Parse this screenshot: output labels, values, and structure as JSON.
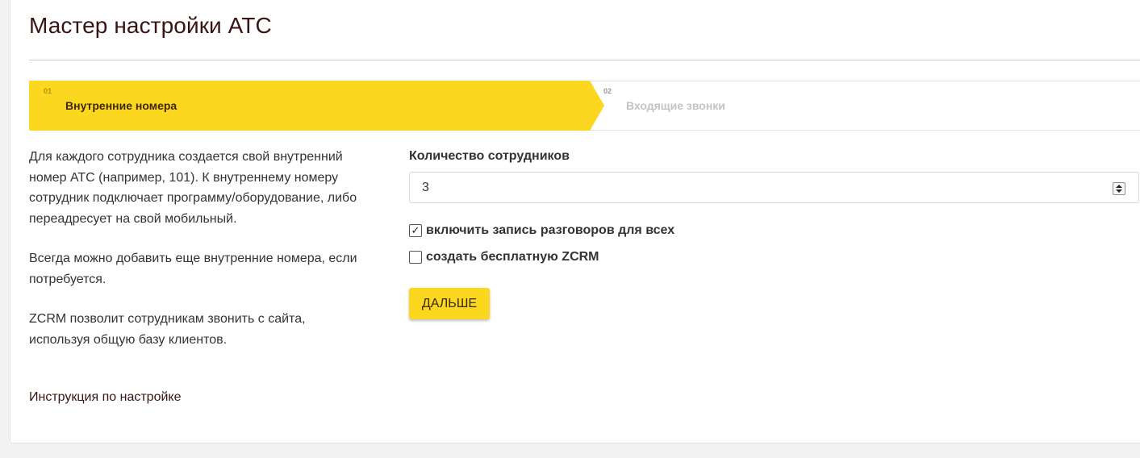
{
  "page_title": "Мастер настройки АТС",
  "steps": [
    {
      "num": "01",
      "label": "Внутренние номера",
      "active": true
    },
    {
      "num": "02",
      "label": "Входящие звонки",
      "active": false
    }
  ],
  "description": [
    "Для каждого сотрудника создается свой внутренний номер АТС (например, 101). К внутреннему номеру сотрудник подключает программу/оборудование, либо переадресует на свой мобильный.",
    "Всегда можно добавить еще внутренние номера, если потребуется.",
    "ZCRM позволит сотрудникам звонить с сайта, используя общую базу клиентов."
  ],
  "instruction_link": "Инструкция по настройке",
  "form": {
    "employees_label": "Количество сотрудников",
    "employees_value": "3",
    "checkboxes": [
      {
        "label": "включить запись разговоров для всех",
        "checked": true,
        "mark": "✓"
      },
      {
        "label": "создать бесплатную ZCRM",
        "checked": false,
        "mark": ""
      }
    ],
    "next_button": "ДАЛЬШЕ"
  },
  "colors": {
    "accent": "#fcd720",
    "title": "#3a1414",
    "text": "#333333"
  }
}
